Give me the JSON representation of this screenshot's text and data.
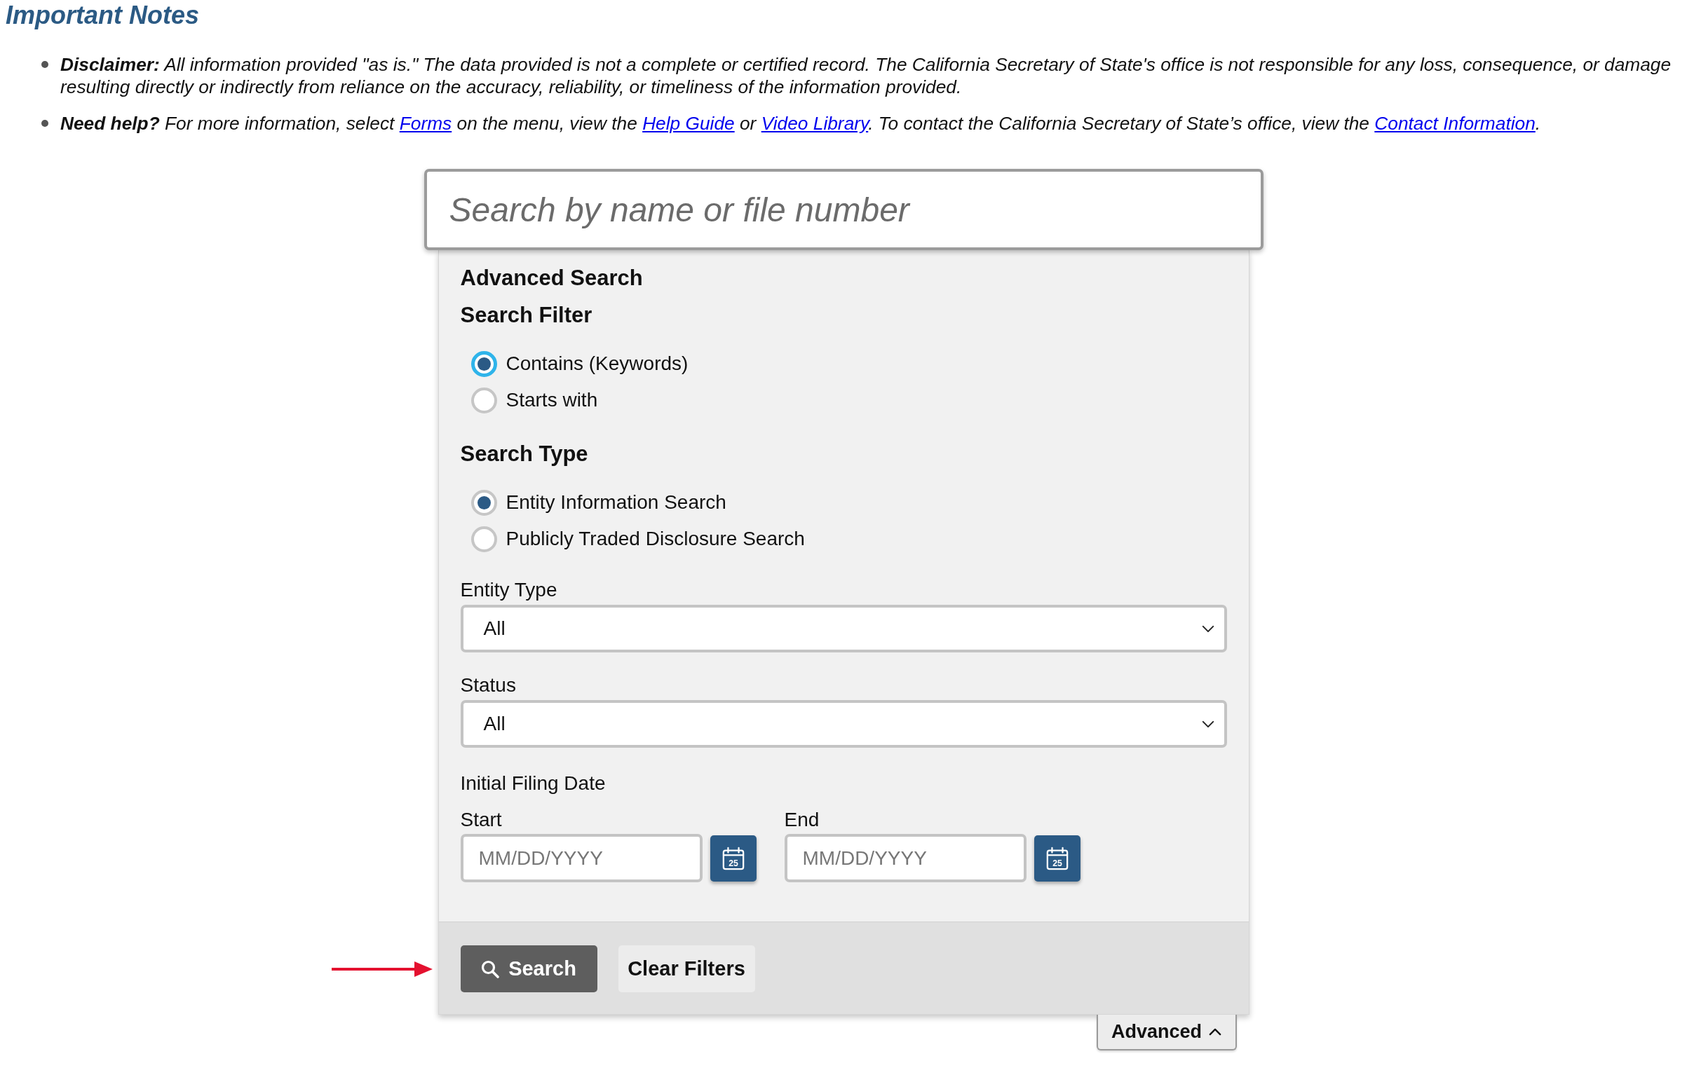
{
  "notes": {
    "title": "Important Notes",
    "items": [
      {
        "parts": [
          {
            "kind": "text",
            "text": "**Disclaimer:** All information provided \"as is.\" The data provided is not a complete or certified record. The California Secretary of State's office is not responsible for any loss, consequence, or damage resulting directly or indirectly from reliance on the accuracy, reliability, or timeliness of the information provided."
          }
        ]
      },
      {
        "parts": [
          {
            "kind": "text",
            "text": "**Need help?** For more information, select "
          },
          {
            "kind": "link",
            "text": "Forms"
          },
          {
            "kind": "text",
            "text": " on the menu, view the "
          },
          {
            "kind": "link",
            "text": "Help Guide"
          },
          {
            "kind": "text",
            "text": " or "
          },
          {
            "kind": "link",
            "text": "Video Library"
          },
          {
            "kind": "text",
            "text": ". To contact the California Secretary of State’s office, view the "
          },
          {
            "kind": "link",
            "text": "Contact Information"
          },
          {
            "kind": "text",
            "text": "."
          }
        ]
      }
    ]
  },
  "search": {
    "placeholder": "Search by name or file number"
  },
  "advanced": {
    "title": "Advanced Search",
    "groups": [
      {
        "title": "Search Filter",
        "options": [
          {
            "label": "Contains (Keywords)",
            "selected": true,
            "focused": true
          },
          {
            "label": "Starts with",
            "selected": false,
            "focused": false
          }
        ]
      },
      {
        "title": "Search Type",
        "options": [
          {
            "label": "Entity Information Search",
            "selected": true,
            "focused": false
          },
          {
            "label": "Publicly Traded Disclosure Search",
            "selected": false,
            "focused": false
          }
        ]
      }
    ],
    "selects": [
      {
        "label": "Entity Type",
        "value": "All"
      },
      {
        "label": "Status",
        "value": "All"
      }
    ],
    "date_range": {
      "label": "Initial Filing Date",
      "fields": [
        {
          "label": "Start",
          "placeholder": "MM/DD/YYYY",
          "calendar_day": "25"
        },
        {
          "label": "End",
          "placeholder": "MM/DD/YYYY",
          "calendar_day": "25"
        }
      ]
    },
    "buttons": [
      {
        "label": "Search",
        "kind": "primary"
      },
      {
        "label": "Clear Filters",
        "kind": "secondary"
      }
    ],
    "annotations": [
      {
        "kind": "arrow"
      }
    ]
  },
  "toggle": {
    "label": "Advanced",
    "expanded": true
  }
}
